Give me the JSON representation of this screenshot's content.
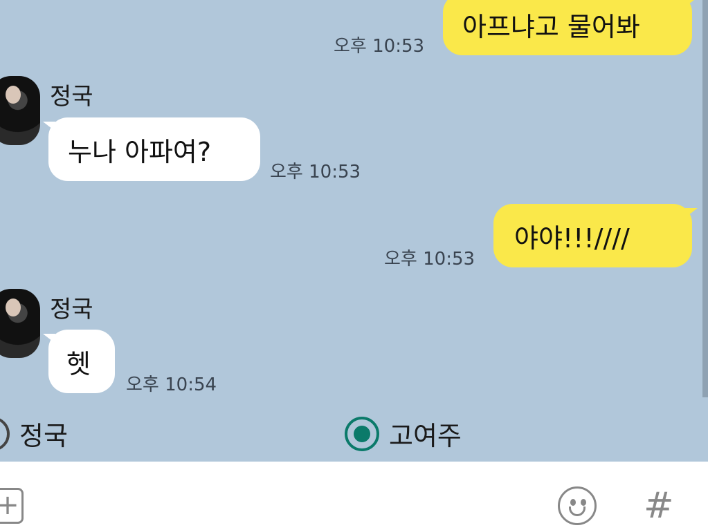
{
  "messages": [
    {
      "sender": "me",
      "text": "아프냐고 물어봐",
      "time": "오후 10:53"
    },
    {
      "sender": "정국",
      "text": "누나 아파여?",
      "time": "오후 10:53"
    },
    {
      "sender": "me",
      "text": "야야!!!////",
      "time": "오후 10:53"
    },
    {
      "sender": "정국",
      "text": "헷",
      "time": "오후 10:54"
    }
  ],
  "poll": {
    "options": [
      {
        "label": "정국",
        "selected": false
      },
      {
        "label": "고여주",
        "selected": true
      }
    ]
  },
  "input_bar": {
    "add_icon": "plus-square-icon",
    "emoji_icon": "smiley-icon",
    "hash_icon": "hash-icon",
    "hash_label": "#",
    "add_label": "+"
  },
  "colors": {
    "background": "#b1c7da",
    "my_bubble": "#fae84a",
    "their_bubble": "#ffffff",
    "selected_radio": "#0b7a6a"
  }
}
